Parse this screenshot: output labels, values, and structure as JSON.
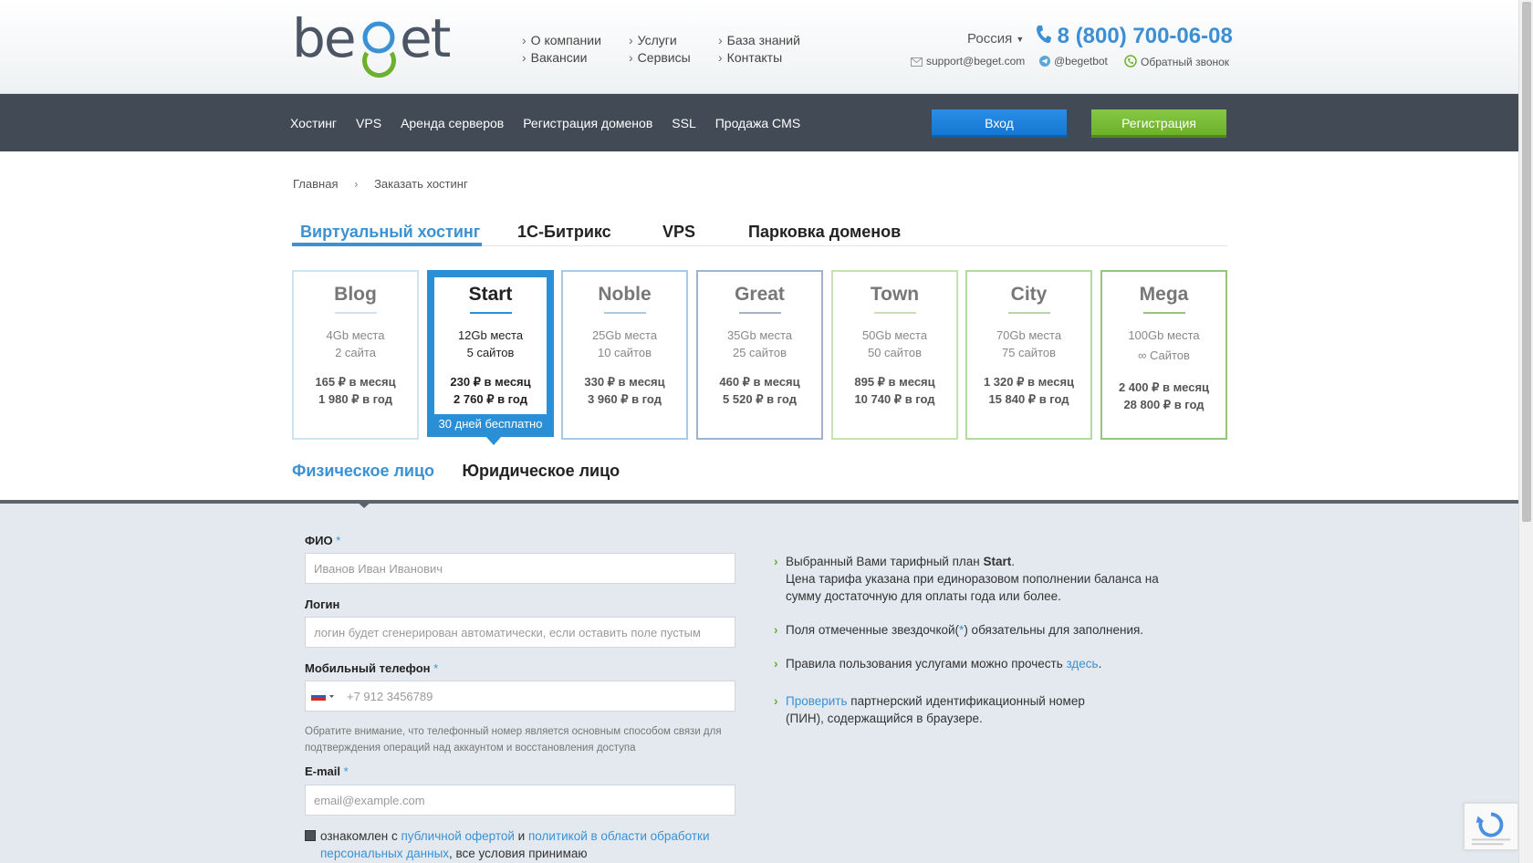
{
  "header": {
    "logo_text": "beget",
    "links_col1": [
      "О компании",
      "Вакансии"
    ],
    "links_col2": [
      "Услуги",
      "Сервисы"
    ],
    "links_col3": [
      "База знаний",
      "Контакты"
    ],
    "region": "Россия",
    "phone": "8 (800) 700-06-08",
    "email": "support@beget.com",
    "telegram": "@begetbot",
    "callback": "Обратный звонок"
  },
  "nav": {
    "items": [
      "Хостинг",
      "VPS",
      "Аренда серверов",
      "Регистрация доменов",
      "SSL",
      "Продажа CMS"
    ],
    "login_label": "Вход",
    "register_label": "Регистрация"
  },
  "breadcrumb": {
    "home": "Главная",
    "current": "Заказать хостинг"
  },
  "product_tabs": [
    "Виртуальный хостинг",
    "1С-Битрикс",
    "VPS",
    "Парковка доменов"
  ],
  "plans": [
    {
      "name": "Blog",
      "space": "4Gb места",
      "sites": "2 сайта",
      "month": "165 ₽ в месяц",
      "year": "1 980 ₽ в год",
      "color": "#cfe3f0"
    },
    {
      "name": "Start",
      "space": "12Gb места",
      "sites": "5 сайтов",
      "month": "230 ₽ в месяц",
      "year": "2 760 ₽ в год",
      "color": "#2b8fd6",
      "promo": "30 дней бесплатно"
    },
    {
      "name": "Noble",
      "space": "25Gb места",
      "sites": "10 сайтов",
      "month": "330 ₽ в месяц",
      "year": "3 960 ₽ в год",
      "color": "#a9c9e4"
    },
    {
      "name": "Great",
      "space": "35Gb места",
      "sites": "25 сайтов",
      "month": "460 ₽ в месяц",
      "year": "5 520 ₽ в год",
      "color": "#9fb4cc"
    },
    {
      "name": "Town",
      "space": "50Gb места",
      "sites": "50 сайтов",
      "month": "895 ₽ в месяц",
      "year": "10 740 ₽ в год",
      "color": "#c6e2b4"
    },
    {
      "name": "City",
      "space": "70Gb места",
      "sites": "75 сайтов",
      "month": "1 320 ₽ в месяц",
      "year": "15 840 ₽ в год",
      "color": "#b4d9a0"
    },
    {
      "name": "Mega",
      "space": "100Gb места",
      "sites": "∞ Сайтов",
      "month": "2 400 ₽ в месяц",
      "year": "28 800 ₽ в год",
      "color": "#93c57d"
    }
  ],
  "person_tabs": [
    "Физическое лицо",
    "Юридическое лицо"
  ],
  "form": {
    "fio_label": "ФИО",
    "fio_placeholder": "Иванов Иван Иванович",
    "login_label": "Логин",
    "login_placeholder": "логин будет сгенерирован автоматически, если оставить поле пустым",
    "phone_label": "Мобильный телефон",
    "phone_placeholder": "+7 912 3456789",
    "phone_note": "Обратите внимание, что телефонный номер является основным способом связи для подтверждения операций над аккаунтом и восстановления доступа",
    "email_label": "E-mail",
    "email_placeholder": "email@example.com",
    "required_mark": "*",
    "agree_prefix": "ознакомлен с ",
    "agree_link1": "публичной офертой",
    "agree_mid": " и ",
    "agree_link2": "политикой в области обработки персональных данных",
    "agree_suffix": ", все условия принимаю"
  },
  "info": {
    "plan_prefix": "Выбранный Вами тарифный план ",
    "plan_name": "Start",
    "plan_note": "Цена тарифа указана при единоразовом пополнении баланса на сумму достаточную для оплаты года или более.",
    "required_note_a": "Поля отмеченные звездочкой(",
    "required_note_star": "*",
    "required_note_b": ") обязательны для заполнения.",
    "rules_prefix": "Правила пользования услугами можно прочесть ",
    "rules_link": "здесь",
    "rules_suffix": ".",
    "check_link": "Проверить",
    "check_text": " партнерский идентификационный номер (ПИН), содержащийся в браузере."
  },
  "colors": {
    "accent": "#3a91d4",
    "green": "#6db02c",
    "nav": "#424a55"
  }
}
